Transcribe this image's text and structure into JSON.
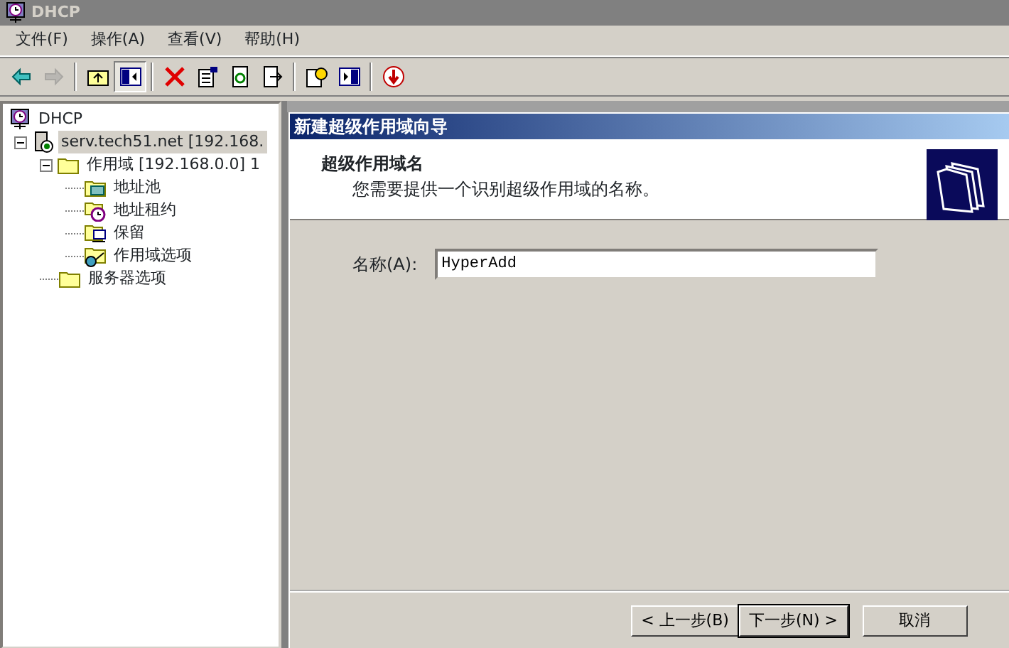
{
  "window": {
    "title": "DHCP"
  },
  "menu": [
    "文件(F)",
    "操作(A)",
    "查看(V)",
    "帮助(H)"
  ],
  "toolbar": [
    {
      "kind": "back",
      "disabled": false,
      "pressed": false
    },
    {
      "kind": "forward",
      "disabled": true,
      "pressed": false
    },
    {
      "kind": "sep"
    },
    {
      "kind": "up",
      "disabled": false,
      "pressed": false
    },
    {
      "kind": "tree",
      "disabled": false,
      "pressed": true
    },
    {
      "kind": "sep"
    },
    {
      "kind": "delete",
      "disabled": false,
      "pressed": false
    },
    {
      "kind": "properties",
      "disabled": false,
      "pressed": false
    },
    {
      "kind": "refresh",
      "disabled": false,
      "pressed": false
    },
    {
      "kind": "export",
      "disabled": false,
      "pressed": false
    },
    {
      "kind": "sep"
    },
    {
      "kind": "help",
      "disabled": false,
      "pressed": false
    },
    {
      "kind": "pane",
      "disabled": false,
      "pressed": false
    },
    {
      "kind": "sep"
    },
    {
      "kind": "stop",
      "disabled": false,
      "pressed": false
    }
  ],
  "tree": [
    {
      "label": "DHCP",
      "kind": "dhcp",
      "selected": false,
      "children": [
        {
          "label": "serv.tech51.net [192.168.",
          "kind": "server",
          "selected": true,
          "expanded": true,
          "children": [
            {
              "label": "作用域 [192.168.0.0] 1",
              "kind": "folder",
              "selected": false,
              "expanded": true,
              "children": [
                {
                  "label": "地址池",
                  "kind": "pool",
                  "selected": false
                },
                {
                  "label": "地址租约",
                  "kind": "lease",
                  "selected": false
                },
                {
                  "label": "保留",
                  "kind": "reserve",
                  "selected": false
                },
                {
                  "label": "作用域选项",
                  "kind": "options",
                  "selected": false
                }
              ]
            },
            {
              "label": "服务器选项",
              "kind": "folder",
              "selected": false
            }
          ]
        }
      ]
    }
  ],
  "dialog": {
    "title": "新建超级作用域向导",
    "heading": "超级作用域名",
    "subheading": "您需要提供一个识别超级作用域的名称。",
    "field": {
      "label": "名称(A):",
      "value": "HyperAdd"
    },
    "buttons": [
      {
        "label": "< 上一步(B)",
        "default": false
      },
      {
        "label": "下一步(N) >",
        "default": true
      },
      {
        "label": "取消",
        "default": false
      }
    ]
  }
}
